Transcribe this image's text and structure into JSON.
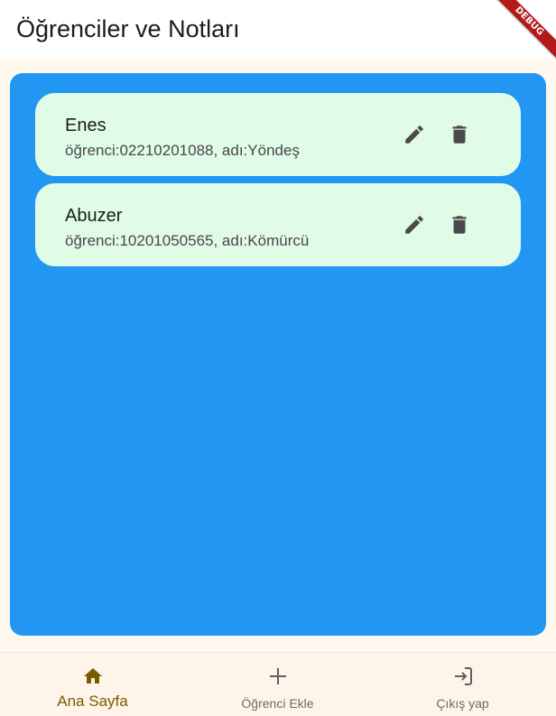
{
  "app_bar": {
    "title": "Öğrenciler ve Notları",
    "debug_label": "DEBUG"
  },
  "students": [
    {
      "name": "Enes",
      "info": "öğrenci:02210201088, adı:Yöndeş",
      "edit_icon": "edit-icon",
      "delete_icon": "delete-icon"
    },
    {
      "name": "Abuzer",
      "info": "öğrenci:10201050565, adı:Kömürcü",
      "edit_icon": "edit-icon",
      "delete_icon": "delete-icon"
    }
  ],
  "bottom_nav": {
    "items": [
      {
        "label": "Ana Sayfa",
        "icon": "home-icon",
        "active": true
      },
      {
        "label": "Öğrenci Ekle",
        "icon": "add-icon",
        "active": false
      },
      {
        "label": "Çıkış yap",
        "icon": "logout-icon",
        "active": false
      }
    ]
  },
  "colors": {
    "panel": "#2196f3",
    "card": "#e1fce6",
    "nav_background": "#fff4ea",
    "active_nav": "#7a5c00",
    "debug_ribbon": "#b31a1a"
  }
}
